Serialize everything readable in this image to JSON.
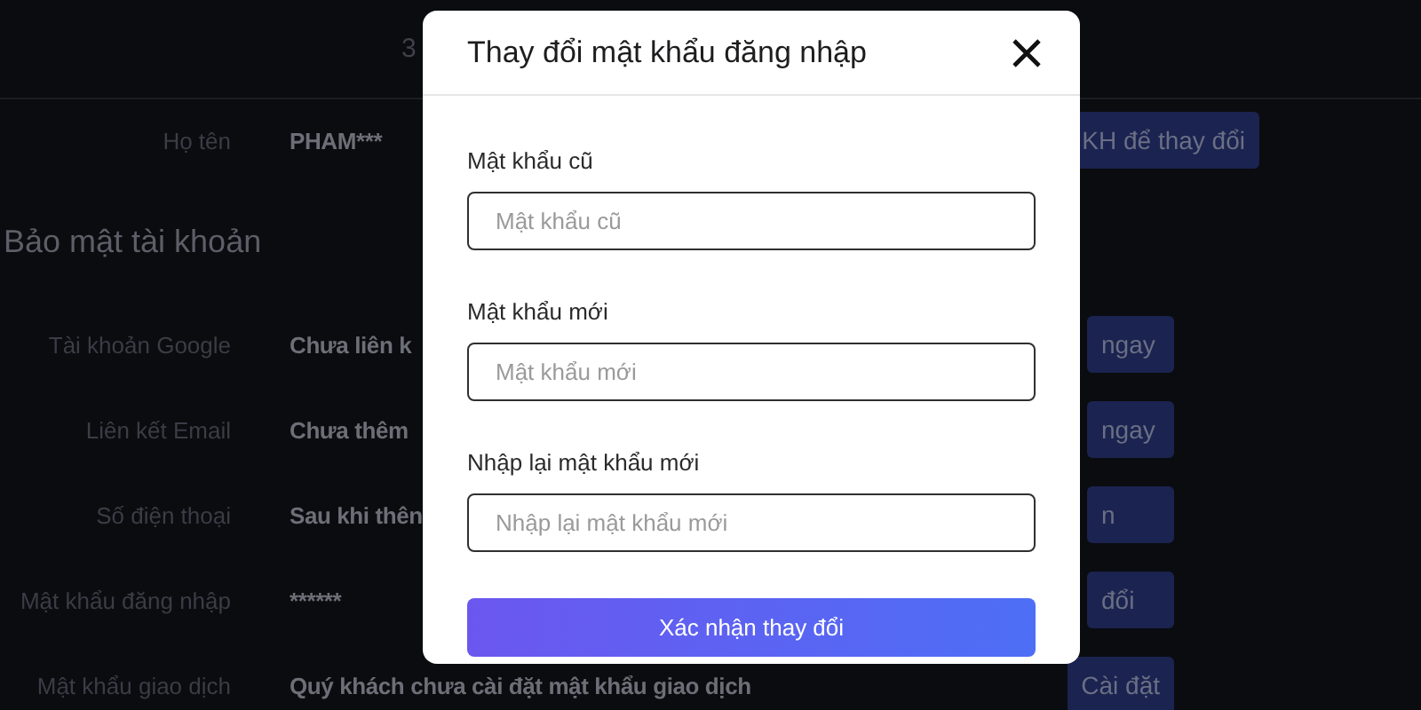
{
  "header": {
    "text": "3"
  },
  "profile": {
    "label": "Họ tên",
    "value": "PHAM***",
    "action": "KH để thay đổi"
  },
  "security": {
    "title": "Bảo mật tài khoản",
    "rows": [
      {
        "label": "Tài khoản Google",
        "value": "Chưa liên k",
        "action": "ngay"
      },
      {
        "label": "Liên kết Email",
        "value": "Chưa thêm",
        "action": "ngay"
      },
      {
        "label": "Số điện thoại",
        "value": "Sau khi thên",
        "action": "n"
      },
      {
        "label": "Mật khẩu đăng nhập",
        "value": "******",
        "action": "đổi"
      },
      {
        "label": "Mật khẩu giao dịch",
        "value": "Quý khách chưa cài đặt mật khẩu giao dịch",
        "action": "Cài đặt"
      }
    ]
  },
  "dialog": {
    "title": "Thay đổi mật khẩu đăng nhập",
    "fields": [
      {
        "label": "Mật khẩu cũ",
        "placeholder": "Mật khẩu cũ"
      },
      {
        "label": "Mật khẩu mới",
        "placeholder": "Mật khẩu mới"
      },
      {
        "label": "Nhập lại mật khẩu mới",
        "placeholder": "Nhập lại mật khẩu mới"
      }
    ],
    "submit": "Xác nhận thay đổi"
  }
}
